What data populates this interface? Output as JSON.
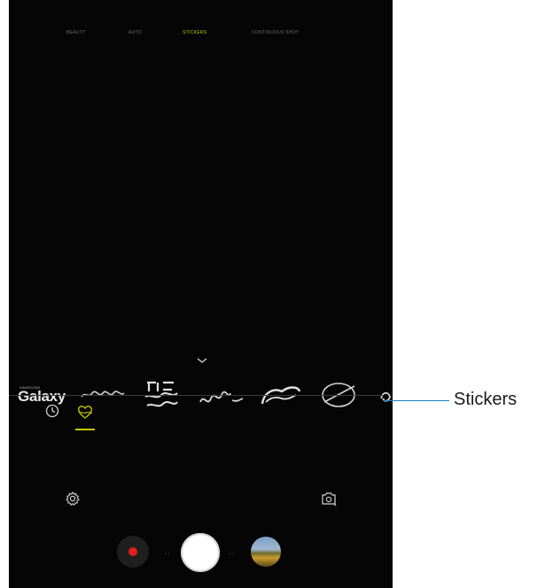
{
  "camera": {
    "modes": [
      {
        "label": "BEAUTY",
        "active": false
      },
      {
        "label": "AUTO",
        "active": false
      },
      {
        "label": "STICKERS",
        "active": true
      },
      {
        "label": "CONTINUOUS SHOT",
        "active": false
      }
    ],
    "stickers": {
      "samsung_label": "SAMSUNG",
      "galaxy_label": "Galaxy",
      "items": [
        "samsung-galaxy",
        "sticker-2",
        "best-friend",
        "sticker-4",
        "sticker-5",
        "sticker-6",
        "sticker-7"
      ]
    },
    "sticker_tabs": [
      {
        "name": "recent",
        "icon": "clock-icon",
        "selected": false
      },
      {
        "name": "stickers",
        "icon": "heart-sticker-icon",
        "selected": true
      }
    ],
    "accent_color": "#c8c800",
    "record_color": "#e41f1f"
  },
  "callout": {
    "label": "Stickers",
    "line_color": "#1a7fc0"
  }
}
